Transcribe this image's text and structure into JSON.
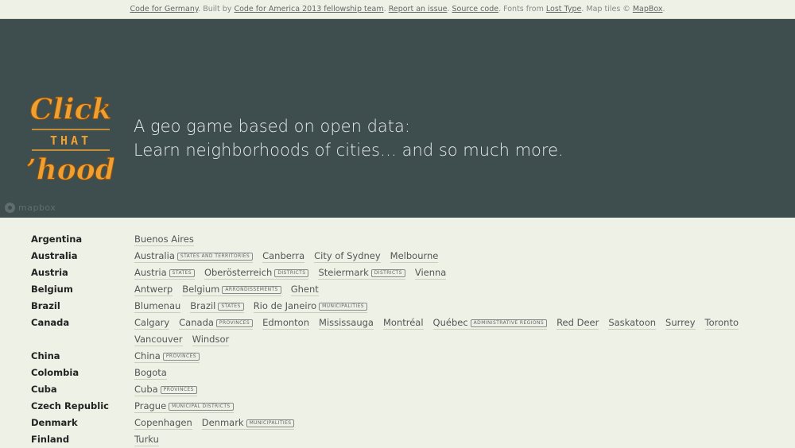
{
  "topbar": {
    "link1": "Code for Germany",
    "text1": ". Built by ",
    "link2": "Code for America 2013 fellowship team",
    "text2": ". ",
    "link3": "Report an issue",
    "text3": ". ",
    "link4": "Source code",
    "text4": ". Fonts from ",
    "link5": "Lost Type",
    "text5": ". Map tiles © ",
    "link6": "MapBox",
    "text6": "."
  },
  "logo": {
    "line1": "Click",
    "line2": "THAT",
    "line3": "’hood"
  },
  "hero": {
    "line1": "A geo game based on open data:",
    "line2": "Learn neighborhoods of cities… and so much more."
  },
  "mapbox_label": "mapbox",
  "colors": {
    "hero_bg": "#3e4e4f",
    "logo_orange": "#f0a030",
    "page_bg": "#eef1e6"
  },
  "countries": [
    {
      "name": "Argentina",
      "cities": [
        {
          "name": "Buenos Aires"
        }
      ]
    },
    {
      "name": "Australia",
      "cities": [
        {
          "name": "Australia",
          "tag": "States and territories"
        },
        {
          "name": "Canberra"
        },
        {
          "name": "City of Sydney"
        },
        {
          "name": "Melbourne"
        }
      ]
    },
    {
      "name": "Austria",
      "cities": [
        {
          "name": "Austria",
          "tag": "States"
        },
        {
          "name": "Oberösterreich",
          "tag": "Districts"
        },
        {
          "name": "Steiermark",
          "tag": "Districts"
        },
        {
          "name": "Vienna"
        }
      ]
    },
    {
      "name": "Belgium",
      "cities": [
        {
          "name": "Antwerp"
        },
        {
          "name": "Belgium",
          "tag": "Arrondissements"
        },
        {
          "name": "Ghent"
        }
      ]
    },
    {
      "name": "Brazil",
      "cities": [
        {
          "name": "Blumenau"
        },
        {
          "name": "Brazil",
          "tag": "States"
        },
        {
          "name": "Rio de Janeiro",
          "tag": "Municipalities"
        }
      ]
    },
    {
      "name": "Canada",
      "cities": [
        {
          "name": "Calgary"
        },
        {
          "name": "Canada",
          "tag": "Provinces"
        },
        {
          "name": "Edmonton"
        },
        {
          "name": "Mississauga"
        },
        {
          "name": "Montréal"
        },
        {
          "name": "Québec",
          "tag": "Administrative regions"
        },
        {
          "name": "Red Deer"
        },
        {
          "name": "Saskatoon"
        },
        {
          "name": "Surrey"
        },
        {
          "name": "Toronto"
        },
        {
          "name": "Vancouver"
        },
        {
          "name": "Windsor"
        }
      ]
    },
    {
      "name": "China",
      "cities": [
        {
          "name": "China",
          "tag": "Provinces"
        }
      ]
    },
    {
      "name": "Colombia",
      "cities": [
        {
          "name": "Bogota"
        }
      ]
    },
    {
      "name": "Cuba",
      "cities": [
        {
          "name": "Cuba",
          "tag": "Provinces"
        }
      ]
    },
    {
      "name": "Czech Republic",
      "cities": [
        {
          "name": "Prague",
          "tag": "Municipal districts"
        }
      ]
    },
    {
      "name": "Denmark",
      "cities": [
        {
          "name": "Copenhagen"
        },
        {
          "name": "Denmark",
          "tag": "Municipalities"
        }
      ]
    },
    {
      "name": "Finland",
      "cities": [
        {
          "name": "Turku"
        }
      ]
    }
  ]
}
